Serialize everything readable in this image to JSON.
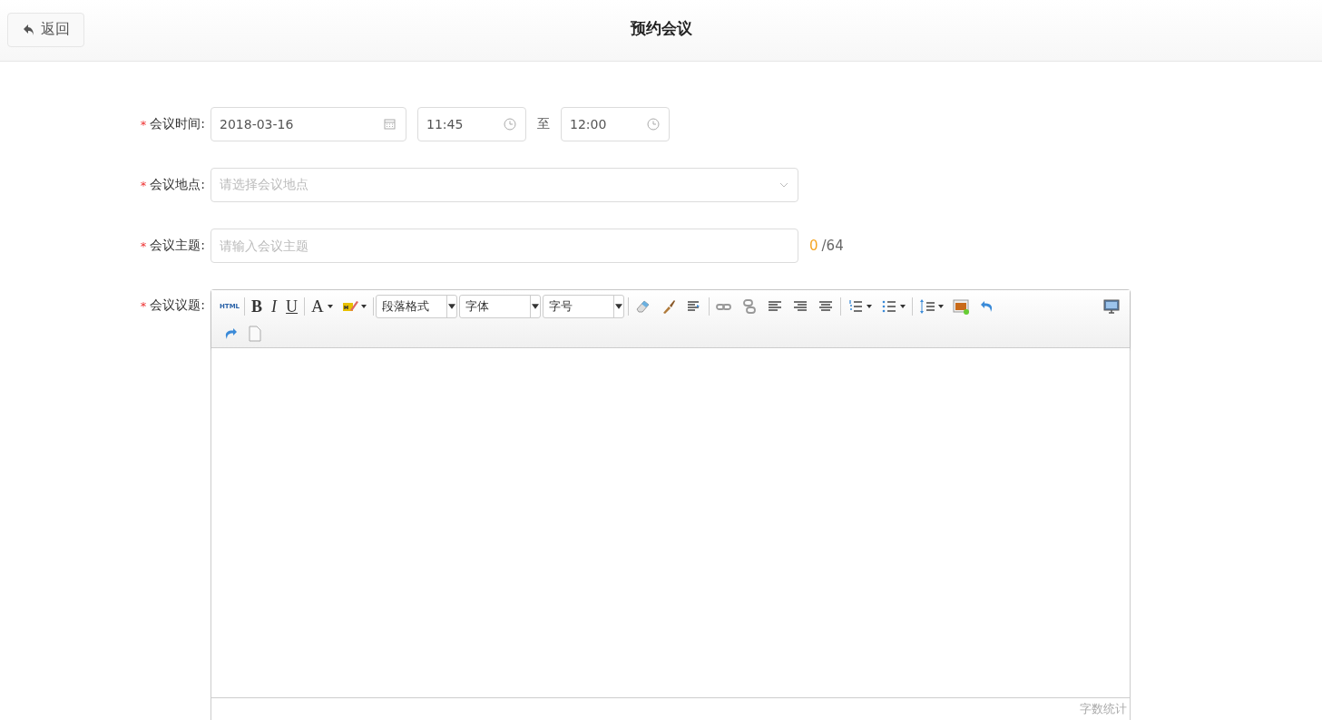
{
  "header": {
    "back_button": "返回",
    "title": "预约会议"
  },
  "form": {
    "time": {
      "label": "会议时间:",
      "required_mark": "*",
      "date": "2018-03-16",
      "start": "11:45",
      "separator": "至",
      "end": "12:00"
    },
    "location": {
      "label": "会议地点:",
      "required_mark": "*",
      "placeholder": "请选择会议地点"
    },
    "subject": {
      "label": "会议主题:",
      "required_mark": "*",
      "placeholder": "请输入会议主题",
      "count": "0",
      "limit": "/64"
    },
    "agenda": {
      "label": "会议议题:",
      "required_mark": "*",
      "toolbar": {
        "html": "HTML",
        "bold": "B",
        "italic": "I",
        "underline": "U",
        "font_color": "A",
        "paragraph_select": "段落格式",
        "font_select": "字体",
        "size_select": "字号"
      },
      "word_count": "字数统计"
    }
  }
}
